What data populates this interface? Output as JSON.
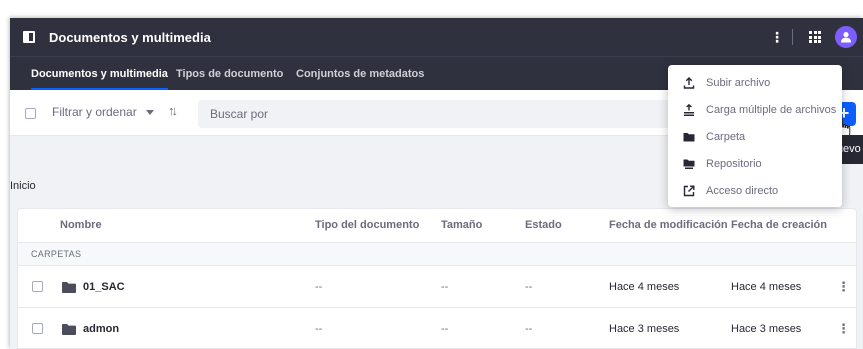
{
  "header": {
    "title": "Documentos y multimedia",
    "kebab": "⋮"
  },
  "nav": {
    "tabs": [
      {
        "label": "Documentos y multimedia",
        "active": true
      },
      {
        "label": "Tipos de documento",
        "active": false
      },
      {
        "label": "Conjuntos de metadatos",
        "active": false
      }
    ]
  },
  "toolbar": {
    "filter_label": "Filtrar y ordenar",
    "search_placeholder": "Buscar por",
    "new_label": "+",
    "new_tooltip": "Nuevo"
  },
  "dropdown": {
    "items": [
      {
        "label": "Subir archivo",
        "icon": "upload-icon"
      },
      {
        "label": "Carga múltiple de archivos",
        "icon": "multiple-upload-icon"
      },
      {
        "label": "Carpeta",
        "icon": "folder-icon"
      },
      {
        "label": "Repositorio",
        "icon": "repository-icon"
      },
      {
        "label": "Acceso directo",
        "icon": "shortcut-icon"
      }
    ]
  },
  "breadcrumb": "Inicio",
  "table": {
    "columns": [
      "Nombre",
      "Tipo del documento",
      "Tamaño",
      "Estado",
      "Fecha de modificación",
      "Fecha de creación"
    ],
    "group_label": "CARPETAS",
    "rows": [
      {
        "name": "01_SAC",
        "type": "--",
        "size": "--",
        "status": "--",
        "modified": "Hace 4 meses",
        "created": "Hace 4 meses"
      },
      {
        "name": "admon",
        "type": "--",
        "size": "--",
        "status": "--",
        "modified": "Hace 3 meses",
        "created": "Hace 3 meses"
      }
    ],
    "row_kebab": "⋮"
  },
  "colors": {
    "header_bg": "#30313f",
    "primary": "#0b5fff",
    "avatar": "#7e5dff"
  }
}
